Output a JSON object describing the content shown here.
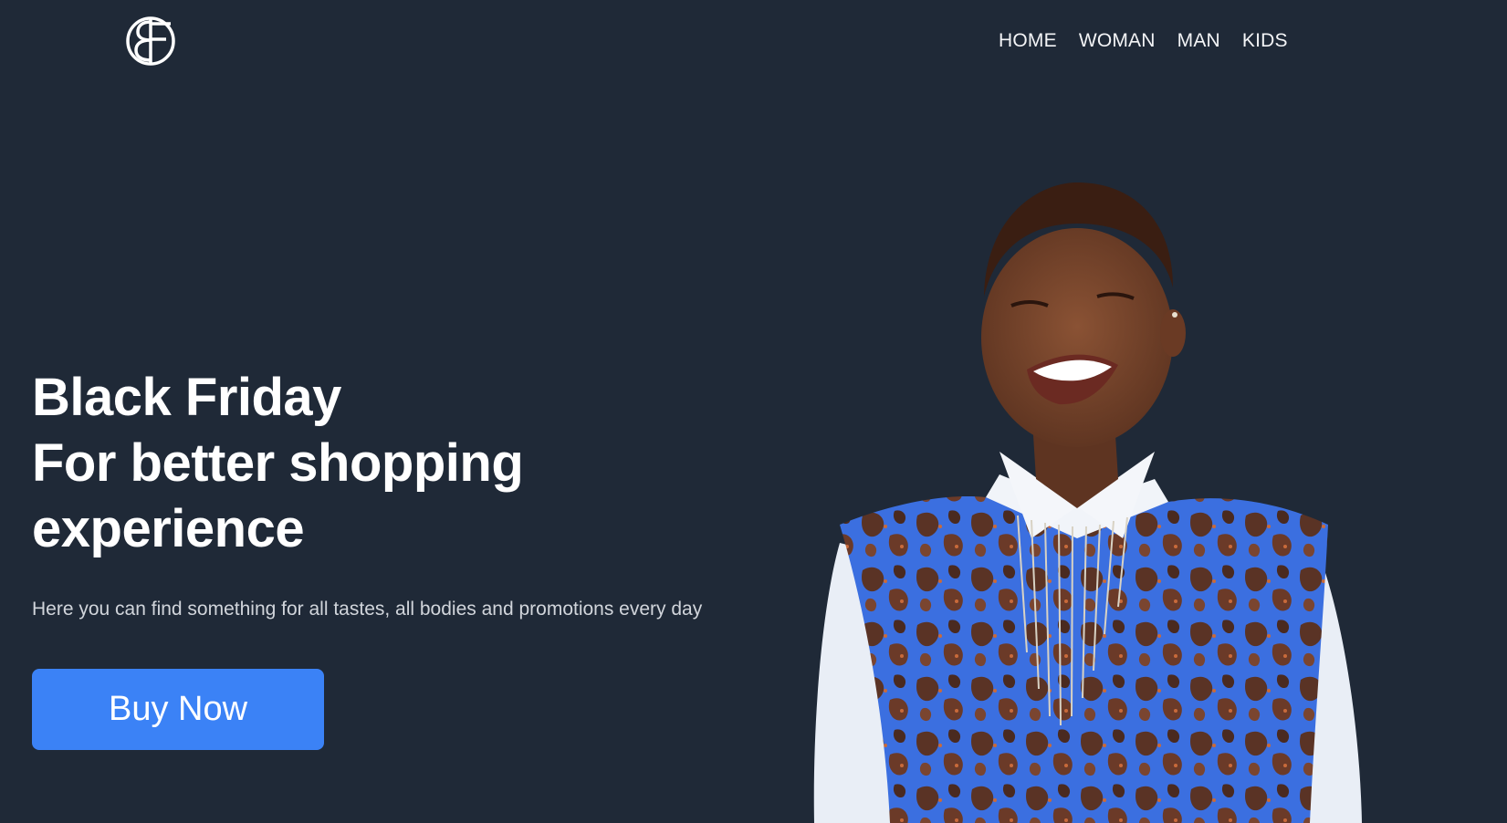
{
  "header": {
    "logo_text": "BF",
    "nav": [
      {
        "label": "HOME"
      },
      {
        "label": "WOMAN"
      },
      {
        "label": "MAN"
      },
      {
        "label": "KIDS"
      }
    ]
  },
  "hero": {
    "headline_line1": "Black Friday",
    "headline_line2": "For better shopping",
    "headline_line3": "experience",
    "subtext": "Here you can find something for all tastes, all bodies and promotions every day",
    "cta_label": "Buy Now"
  },
  "colors": {
    "background": "#1f2937",
    "accent": "#3b82f6",
    "text": "#ffffff",
    "muted_text": "#d1d5db"
  }
}
